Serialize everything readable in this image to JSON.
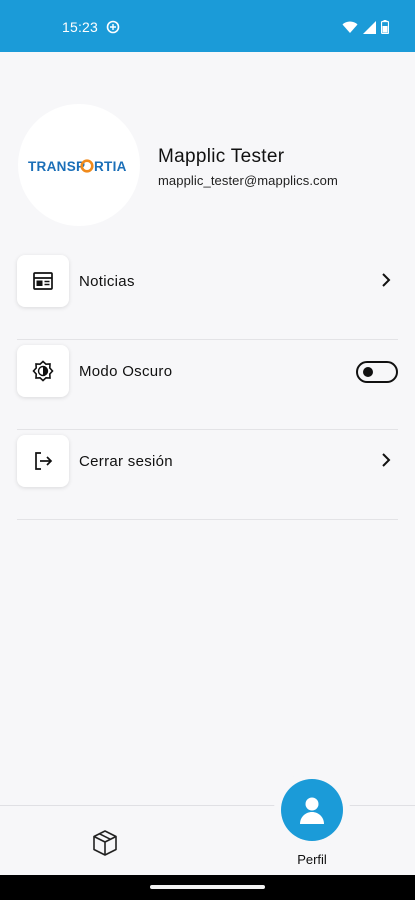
{
  "status_bar": {
    "time": "15:23",
    "color": "#1b9bd8"
  },
  "profile": {
    "logo_text": "TRANSPORTIA",
    "name": "Mapplic Tester",
    "email": "mapplic_tester@mapplics.com"
  },
  "menu": {
    "items": [
      {
        "label": "Noticias",
        "icon": "newspaper-icon",
        "action": "chevron-right-icon"
      },
      {
        "label": "Modo Oscuro",
        "icon": "brightness-icon",
        "action": "toggle",
        "toggle_on": false
      },
      {
        "label": "Cerrar sesión",
        "icon": "logout-icon",
        "action": "chevron-right-icon"
      }
    ]
  },
  "bottom_nav": {
    "items": [
      {
        "icon": "package-icon",
        "label": ""
      },
      {
        "icon": "person-icon",
        "label": "Perfil",
        "active": true
      }
    ],
    "accent": "#1b9bd8"
  }
}
